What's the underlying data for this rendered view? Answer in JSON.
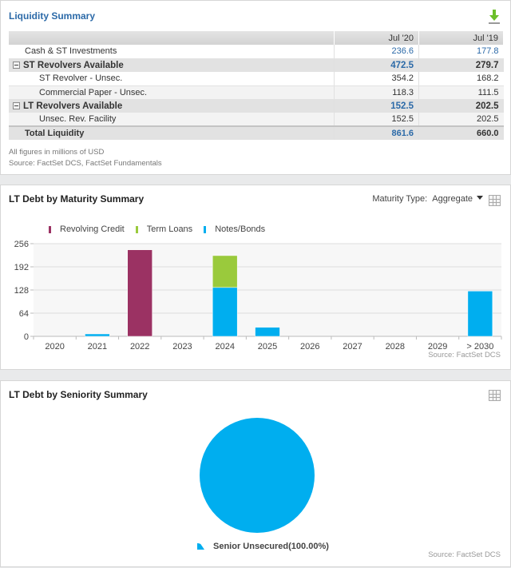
{
  "liquidity": {
    "title": "Liquidity Summary",
    "download_icon": "download-icon",
    "columns": [
      "",
      "Jul '20",
      "Jul '19"
    ],
    "rows": [
      {
        "label": "Cash & ST Investments",
        "v1": "236.6",
        "v2": "177.8",
        "type": "plain"
      },
      {
        "label": "ST Revolvers Available",
        "v1": "472.5",
        "v2": "279.7",
        "type": "group"
      },
      {
        "label": "ST Revolver - Unsec.",
        "v1": "354.2",
        "v2": "168.2",
        "type": "plain"
      },
      {
        "label": "Commercial Paper - Unsec.",
        "v1": "118.3",
        "v2": "111.5",
        "type": "alt"
      },
      {
        "label": "LT Revolvers Available",
        "v1": "152.5",
        "v2": "202.5",
        "type": "group"
      },
      {
        "label": "Unsec. Rev. Facility",
        "v1": "152.5",
        "v2": "202.5",
        "type": "alt"
      },
      {
        "label": "Total Liquidity",
        "v1": "861.6",
        "v2": "660.0",
        "type": "total"
      }
    ],
    "footnote1": "All figures in millions of USD",
    "footnote2": "Source: FactSet DCS, FactSet Fundamentals"
  },
  "maturity": {
    "title": "LT Debt by Maturity Summary",
    "type_label": "Maturity Type:",
    "type_value": "Aggregate",
    "source": "Source: FactSet DCS"
  },
  "seniority": {
    "title": "LT Debt by Seniority Summary",
    "source": "Source: FactSet DCS"
  },
  "colors": {
    "revolving": "#9b3263",
    "term": "#9aca3c",
    "notes": "#00aeef",
    "link_blue": "#2c6aa8"
  },
  "chart_data": [
    {
      "type": "bar",
      "stacked": true,
      "title": "LT Debt by Maturity Summary",
      "xlabel": "",
      "ylabel": "",
      "categories": [
        "2020",
        "2021",
        "2022",
        "2023",
        "2024",
        "2025",
        "2026",
        "2027",
        "2028",
        "2029",
        "> 2030"
      ],
      "series": [
        {
          "name": "Revolving Credit",
          "color": "#9b3263",
          "values": [
            0,
            0,
            239,
            0,
            0,
            0,
            0,
            0,
            0,
            0,
            0
          ]
        },
        {
          "name": "Term Loans",
          "color": "#9aca3c",
          "values": [
            0,
            0,
            0,
            0,
            88,
            0,
            0,
            0,
            0,
            0,
            0
          ]
        },
        {
          "name": "Notes/Bonds",
          "color": "#00aeef",
          "values": [
            0,
            6.6,
            0,
            0,
            135,
            25,
            0,
            0,
            0,
            0,
            125
          ]
        }
      ],
      "yticks": [
        0,
        64,
        128,
        192,
        256
      ],
      "ylim": [
        0,
        256
      ],
      "grid": true,
      "legend": "top-left"
    },
    {
      "type": "pie",
      "title": "LT Debt by Seniority Summary",
      "slices": [
        {
          "label": "Senior Unsecured(100.00%)",
          "value": 100.0,
          "color": "#00aeef"
        }
      ],
      "legend": "bottom"
    }
  ]
}
